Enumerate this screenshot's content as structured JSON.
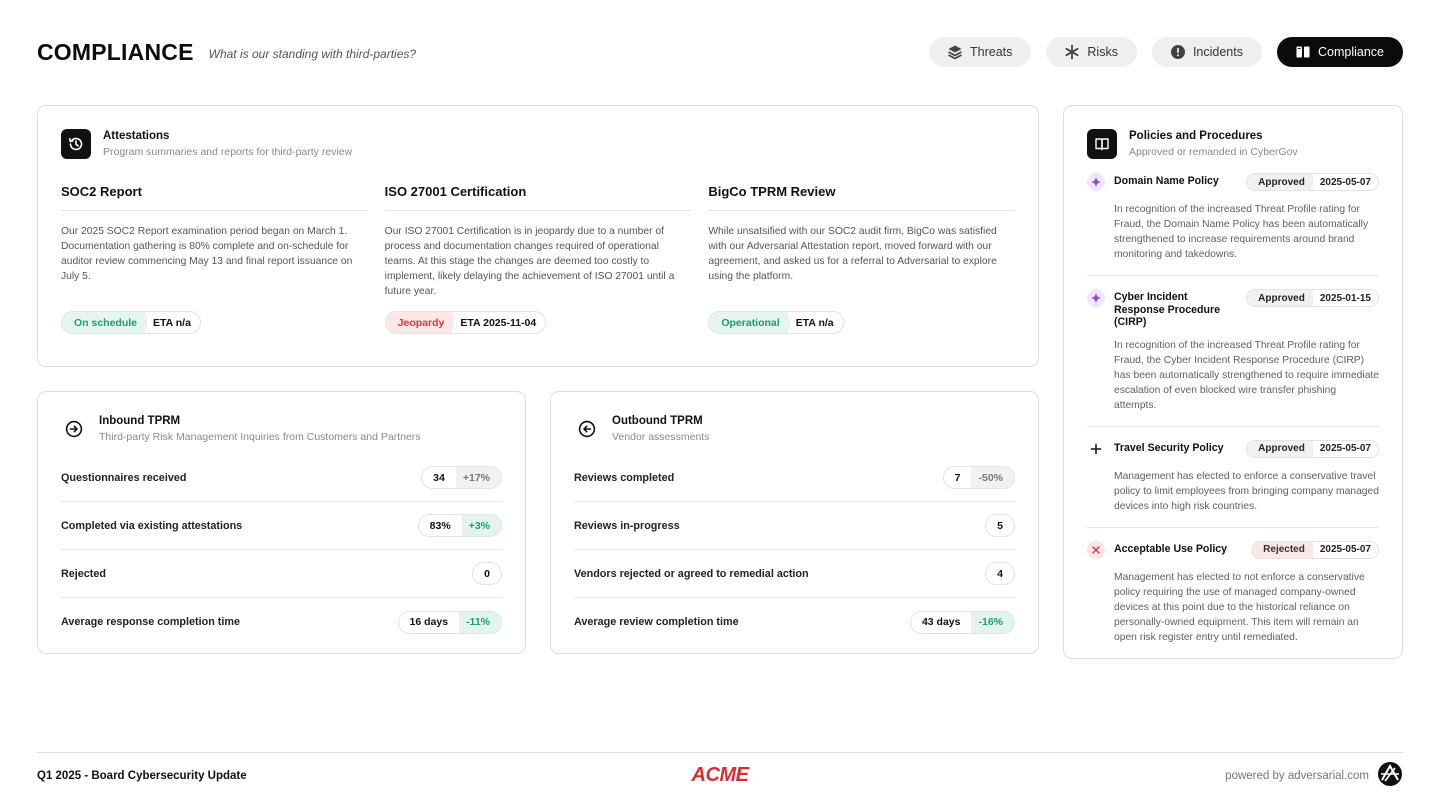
{
  "header": {
    "title": "COMPLIANCE",
    "subtitle": "What is our standing with third-parties?",
    "nav": [
      {
        "label": "Threats",
        "icon": "layers-icon"
      },
      {
        "label": "Risks",
        "icon": "asterisk-icon"
      },
      {
        "label": "Incidents",
        "icon": "alert-circle-icon"
      },
      {
        "label": "Compliance",
        "icon": "book-icon",
        "active": true
      }
    ]
  },
  "attestations": {
    "title": "Attestations",
    "subtitle": "Program summaries and reports for third-party review",
    "icon": "history-icon",
    "items": [
      {
        "title": "SOC2 Report",
        "body": "Our 2025 SOC2 Report examination period began on March 1. Documentation gathering is 80% complete and on-schedule for auditor review commencing May 13 and final report issuance on July 5.",
        "status": "On schedule",
        "eta": "ETA n/a"
      },
      {
        "title": "ISO 27001 Certification",
        "body": "Our ISO 27001 Certification is in jeopardy due to a number of process and documentation changes required of operational teams. At this stage the changes are deemed too costly to implement, likely delaying the achievement of ISO 27001 until a future year.",
        "status": "Jeopardy",
        "eta": "ETA 2025-11-04"
      },
      {
        "title": "BigCo TPRM Review",
        "body": "While unsatsified with our SOC2 audit firm, BigCo was satisfied with our Adversarial Attestation report, moved forward with our agreement, and asked us for a referral to Adversarial to explore using the platform.",
        "status": "Operational",
        "eta": "ETA n/a"
      }
    ]
  },
  "inbound": {
    "title": "Inbound TPRM",
    "subtitle": "Third-party Risk Management Inquiries from Customers and Partners",
    "icon": "arrow-right-circle-icon",
    "rows": [
      {
        "label": "Questionnaires received",
        "value": "34",
        "delta": "+17%"
      },
      {
        "label": "Completed via existing attestations",
        "value": "83%",
        "delta": "+3%"
      },
      {
        "label": "Rejected",
        "value": "0"
      },
      {
        "label": "Average response completion time",
        "value": "16 days",
        "delta": "-11%"
      }
    ]
  },
  "outbound": {
    "title": "Outbound TPRM",
    "subtitle": "Vendor assessments",
    "icon": "arrow-left-circle-icon",
    "rows": [
      {
        "label": "Reviews completed",
        "value": "7",
        "delta": "-50%"
      },
      {
        "label": "Reviews in-progress",
        "value": "5"
      },
      {
        "label": "Vendors rejected or agreed to remedial action",
        "value": "4"
      },
      {
        "label": "Average review completion time",
        "value": "43 days",
        "delta": "-16%"
      }
    ]
  },
  "policies": {
    "title": "Policies and Procedures",
    "subtitle": "Approved or remanded in CyberGov",
    "icon": "book-open-icon",
    "items": [
      {
        "name": "Domain Name Policy",
        "status": "Approved",
        "date": "2025-05-07",
        "icon": "sparkle-icon",
        "body": "In recognition of the increased Threat Profile rating for Fraud, the Domain Name Policy has been automatically strengthened to increase requirements around brand monitoring and takedowns."
      },
      {
        "name": "Cyber Incident Response Procedure (CIRP)",
        "status": "Approved",
        "date": "2025-01-15",
        "icon": "sparkle-icon",
        "body": "In recognition of the increased Threat Profile rating for Fraud, the Cyber Incident Response Procedure (CIRP) has been automatically strengthened to require immediate escalation of even blocked wire transfer phishing attempts."
      },
      {
        "name": "Travel Security Policy",
        "status": "Approved",
        "date": "2025-05-07",
        "icon": "plus-icon",
        "body": "Management has elected to enforce a conservative travel policy to limit employees from bringing company managed devices into high risk countries."
      },
      {
        "name": "Acceptable Use Policy",
        "status": "Rejected",
        "date": "2025-05-07",
        "icon": "x-icon",
        "body": "Management has elected to not enforce a conservative policy requiring the use of managed company-owned devices at this point due to the historical reliance on personally-owned equipment. This item will remain an open risk register entry until remediated."
      }
    ]
  },
  "footer": {
    "left": "Q1 2025 - Board Cybersecurity Update",
    "logo": "ACME",
    "right": "powered by adversarial.com"
  },
  "colors": {
    "green": "#1e9c6c",
    "red": "#d13b3b",
    "purple": "#8b4fe0",
    "logo_red": "#d72f2f"
  }
}
